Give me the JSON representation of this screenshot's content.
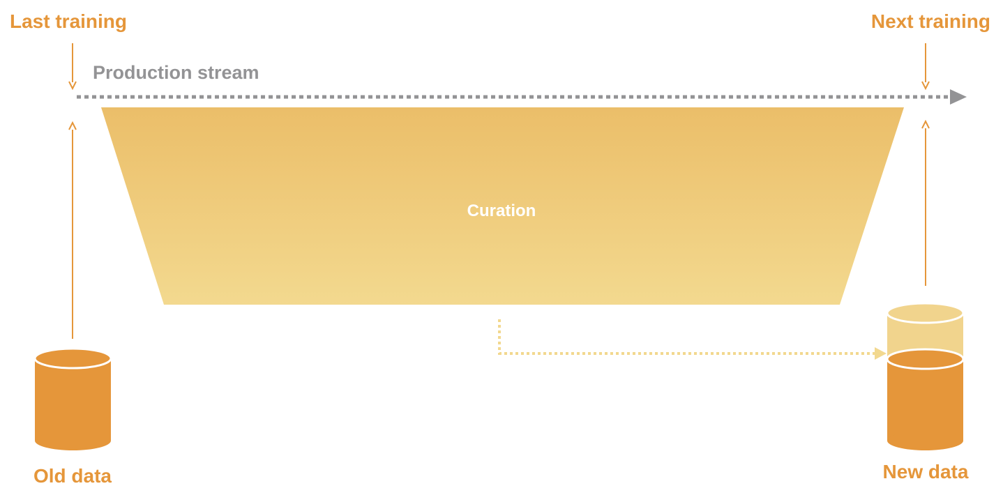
{
  "labels": {
    "last_training": "Last training",
    "next_training": "Next training",
    "production_stream": "Production stream",
    "curation": "Curation",
    "old_data": "Old data",
    "new_data": "New data"
  },
  "colors": {
    "orange": "#E5963A",
    "gray": "#939395",
    "gold_top": "#EBBE69",
    "gold_bottom": "#F3D98F",
    "light_gold": "#F2D88F",
    "cylinder_dark": "#E5963A",
    "cylinder_light": "#F1D48D",
    "white": "#FFFFFF"
  }
}
